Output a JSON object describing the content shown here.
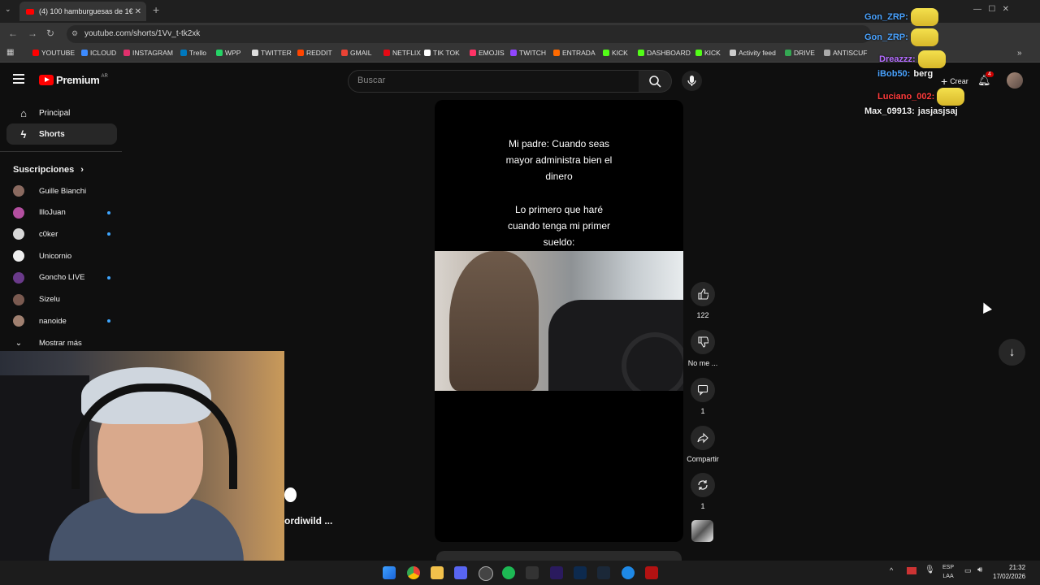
{
  "browser": {
    "tab_title": "(4) 100 hamburguesas de 1€ #",
    "url": "youtube.com/shorts/1Vv_t-tk2xk",
    "bookmarks": [
      {
        "label": "YOUTUBE",
        "color": "#ff0000"
      },
      {
        "label": "ICLOUD",
        "color": "#3d8bff"
      },
      {
        "label": "INSTAGRAM",
        "color": "#e1306c"
      },
      {
        "label": "Trello",
        "color": "#0079bf"
      },
      {
        "label": "WPP",
        "color": "#25d366"
      },
      {
        "label": "TWITTER",
        "color": "#dddddd"
      },
      {
        "label": "REDDIT",
        "color": "#ff4500"
      },
      {
        "label": "GMAIL",
        "color": "#ea4335"
      },
      {
        "label": "NETFLIX",
        "color": "#e50914"
      },
      {
        "label": "TIK TOK",
        "color": "#ffffff"
      },
      {
        "label": "EMOJIS",
        "color": "#ff3366"
      },
      {
        "label": "TWITCH",
        "color": "#9146ff"
      },
      {
        "label": "ENTRADA",
        "color": "#ff6a00"
      },
      {
        "label": "KICK",
        "color": "#53fc18"
      },
      {
        "label": "DASHBOARD",
        "color": "#53fc18"
      },
      {
        "label": "KICK",
        "color": "#53fc18"
      },
      {
        "label": "Activity feed",
        "color": "#cccccc"
      },
      {
        "label": "DRIVE",
        "color": "#34a853"
      },
      {
        "label": "ANTISCUF",
        "color": "#aaaaaa"
      }
    ]
  },
  "youtube": {
    "logo_text": "Premium",
    "region": "AR",
    "search_placeholder": "Buscar",
    "create_label": "Crear",
    "notification_count": "4",
    "nav": [
      {
        "label": "Principal",
        "icon": "home-icon"
      },
      {
        "label": "Shorts",
        "icon": "shorts-icon"
      }
    ],
    "subscriptions_title": "Suscripciones",
    "subscriptions": [
      {
        "name": "Guille Bianchi",
        "dot": false,
        "color": "#8a6a60"
      },
      {
        "name": "IlloJuan",
        "dot": true,
        "color": "#b34fa0"
      },
      {
        "name": "c0ker",
        "dot": true,
        "color": "#d8d8d8"
      },
      {
        "name": "Unicornio",
        "dot": false,
        "color": "#eeeeee"
      },
      {
        "name": "Goncho LIVE",
        "dot": true,
        "color": "#6a3a8a"
      },
      {
        "name": "Sizelu",
        "dot": false,
        "color": "#7a5a50"
      },
      {
        "name": "nanoide",
        "dot": true,
        "color": "#a08070"
      }
    ],
    "show_more": "Mostrar más",
    "short": {
      "caption_top": [
        "Mi padre: Cuando seas",
        "mayor administra bien el",
        "dinero"
      ],
      "caption_bottom": [
        "Lo primero que haré",
        "cuando tenga mi primer",
        "sueldo:"
      ],
      "channel_partial": "ordiwild ..."
    },
    "actions": {
      "likes": "122",
      "dislike": "No me ...",
      "comments": "1",
      "share": "Compartir",
      "remix": "1"
    }
  },
  "chat": [
    {
      "user": "Gon_ZRP:",
      "color": "#4aa3ff",
      "msg": "",
      "emote": true
    },
    {
      "user": "Gon_ZRP:",
      "color": "#4aa3ff",
      "msg": "",
      "emote": true
    },
    {
      "user": "Dreazzz:",
      "color": "#b46cff",
      "msg": "",
      "emote": true
    },
    {
      "user": "iBob50:",
      "color": "#4aa3ff",
      "msg": "berg",
      "emote": false
    },
    {
      "user": "Luciano_002:",
      "color": "#ff3b3b",
      "msg": "",
      "emote": true
    },
    {
      "user": "Max_09913:",
      "color": "#f1f1f1",
      "msg": "jasjasjsaj",
      "emote": false
    }
  ],
  "taskbar": {
    "lang_line1": "ESP",
    "lang_line2": "LAA",
    "time": "21:32",
    "date": "17/02/2026"
  }
}
